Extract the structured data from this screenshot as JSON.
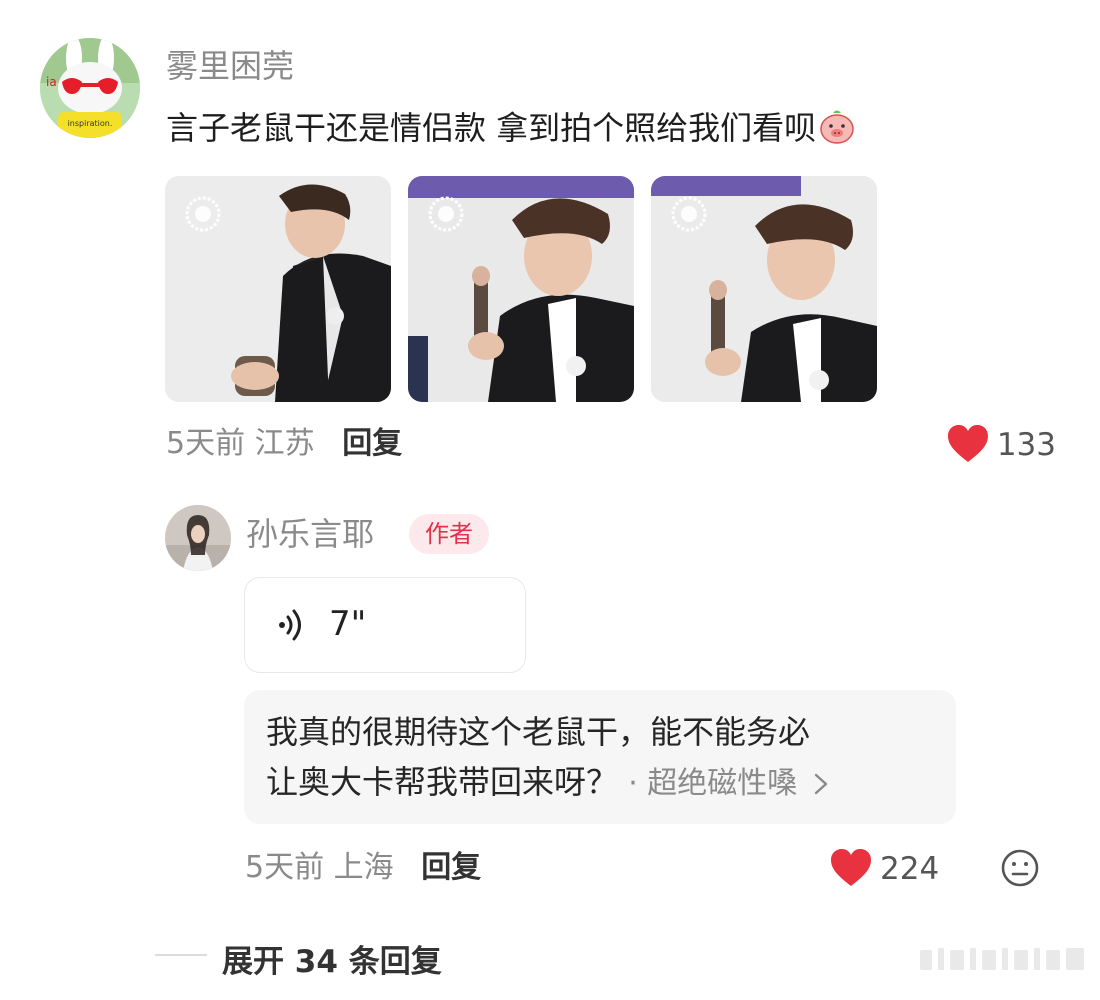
{
  "comment": {
    "username": "雾里困莞",
    "text": "言子老鼠干还是情侣款 拿到拍个照给我们看呗",
    "emoji_icon": "pig-face-emoji",
    "time": "5天前",
    "location": "江苏",
    "reply_label": "回复",
    "like_count": "133",
    "images": [
      "photo-1",
      "photo-2",
      "photo-3"
    ]
  },
  "reply": {
    "username": "孙乐言耶",
    "author_badge": "作者",
    "voice_duration": "7\"",
    "quote_text_line1": "我真的很期待这个老鼠干，能不能务必",
    "quote_text_line2": "让奥大卡帮我带回来呀？",
    "quote_source": "· 超绝磁性嗓",
    "time": "5天前",
    "location": "上海",
    "reply_label": "回复",
    "like_count": "224"
  },
  "expand_label": "展开 34 条回复",
  "colors": {
    "like_red": "#e8323f",
    "author_tag_bg": "#fde9ec",
    "author_tag_text": "#e0324b"
  }
}
